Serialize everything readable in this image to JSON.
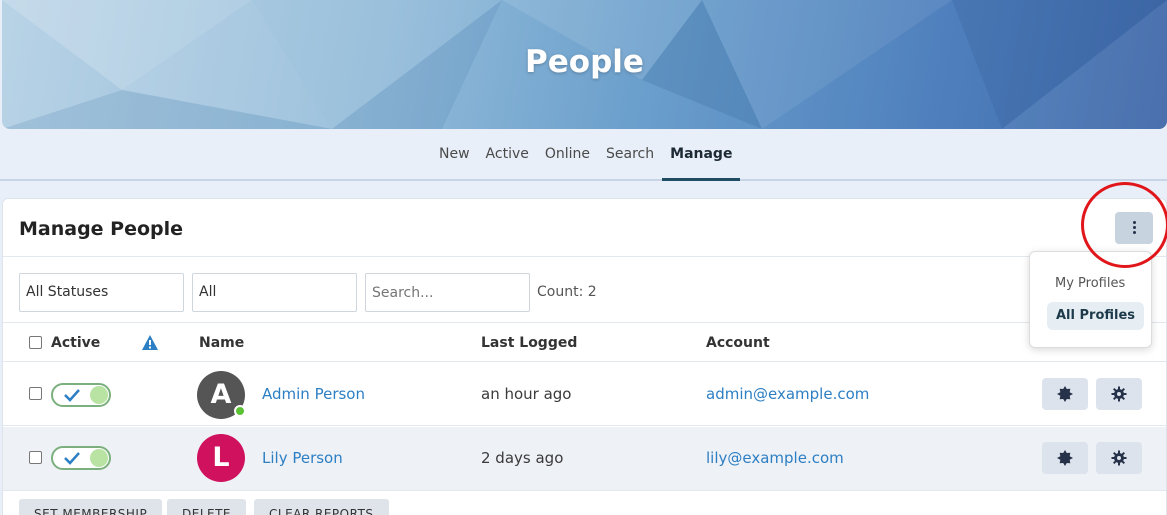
{
  "banner": {
    "title": "People"
  },
  "subnav": {
    "tabs": [
      "New",
      "Active",
      "Online",
      "Search",
      "Manage"
    ],
    "active": "Manage"
  },
  "card": {
    "title": "Manage People",
    "filters": {
      "status": "All Statuses",
      "type": "All",
      "search_placeholder": "Search...",
      "count": "Count: 2"
    },
    "columns": {
      "active": "Active",
      "name": "Name",
      "last_logged": "Last Logged",
      "account": "Account"
    },
    "rows": [
      {
        "initial": "A",
        "avatar_color": "#555555",
        "online": true,
        "name": "Admin Person",
        "last_logged": "an hour ago",
        "account": "admin@example.com",
        "active": true
      },
      {
        "initial": "L",
        "avatar_color": "#d0115e",
        "online": false,
        "name": "Lily Person",
        "last_logged": "2 days ago",
        "account": "lily@example.com",
        "active": true
      }
    ],
    "bottom_buttons": [
      "SET MEMBERSHIP",
      "DELETE",
      "CLEAR REPORTS"
    ]
  },
  "dropdown": {
    "items": [
      "My Profiles",
      "All Profiles"
    ],
    "selected": "All Profiles"
  },
  "colors": {
    "accent": "#1f4e64",
    "link": "#2d7fc4",
    "toggle_on": "#b9e3a3",
    "annotation": "#e0161b",
    "warning": "#2d7fc4"
  }
}
